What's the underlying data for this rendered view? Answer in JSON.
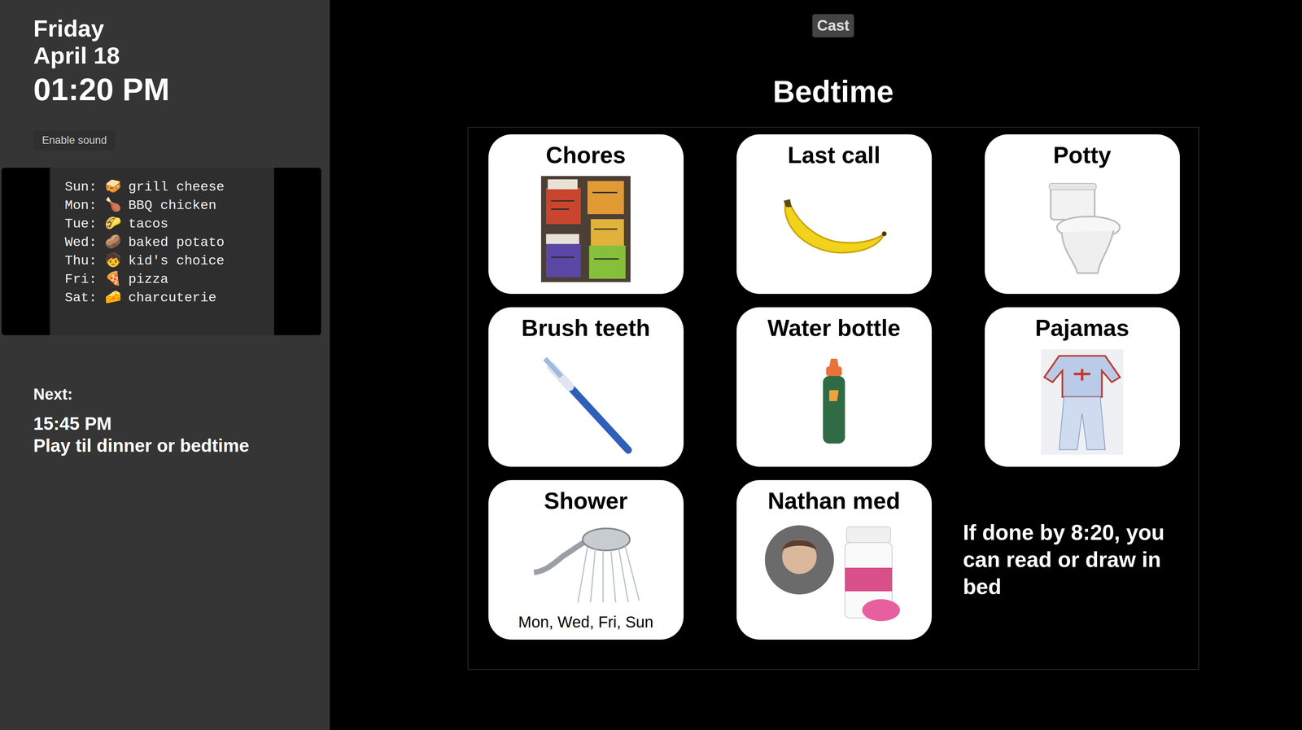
{
  "clock": {
    "day": "Friday",
    "date": "April 18",
    "time": "01:20 PM"
  },
  "sound_button": "Enable sound",
  "menu": [
    {
      "day": "Sun:",
      "emoji": "🥪",
      "meal": "grill cheese"
    },
    {
      "day": "Mon:",
      "emoji": "🍗",
      "meal": "BBQ chicken"
    },
    {
      "day": "Tue:",
      "emoji": "🌮",
      "meal": "tacos"
    },
    {
      "day": "Wed:",
      "emoji": "🥔",
      "meal": "baked potato"
    },
    {
      "day": "Thu:",
      "emoji": "🧒",
      "meal": "kid's choice"
    },
    {
      "day": "Fri:",
      "emoji": "🍕",
      "meal": "pizza"
    },
    {
      "day": "Sat:",
      "emoji": "🧀",
      "meal": "charcuterie"
    }
  ],
  "next": {
    "label": "Next:",
    "time": "15:45 PM",
    "activity": "Play til dinner or bedtime"
  },
  "cast_button": "Cast",
  "routine": {
    "title": "Bedtime",
    "cards": [
      {
        "label": "Chores",
        "kind": "chores"
      },
      {
        "label": "Last call",
        "kind": "banana"
      },
      {
        "label": "Potty",
        "kind": "toilet"
      },
      {
        "label": "Brush teeth",
        "kind": "toothbrush"
      },
      {
        "label": "Water bottle",
        "kind": "bottle"
      },
      {
        "label": "Pajamas",
        "kind": "pajamas"
      },
      {
        "label": "Shower",
        "kind": "shower",
        "note": "Mon, Wed, Fri, Sun"
      },
      {
        "label": "Nathan med",
        "kind": "medicine"
      }
    ],
    "note": "If done by 8:20, you can read or draw in bed"
  }
}
